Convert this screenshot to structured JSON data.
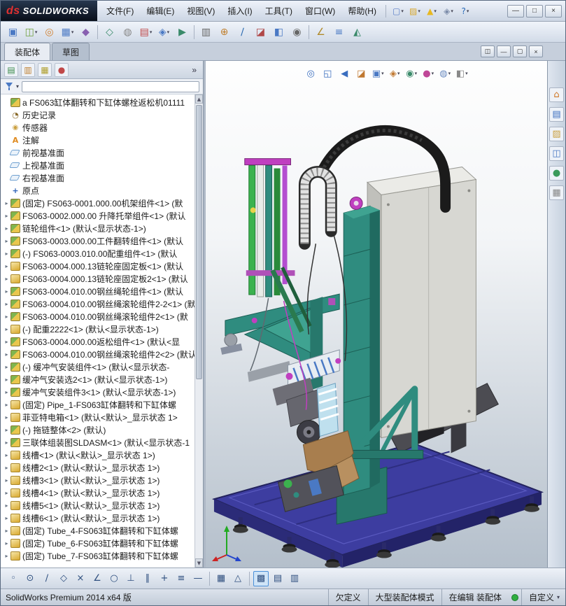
{
  "ui": {
    "dropdown_glyph": "▾"
  },
  "titlebar": {
    "brand": {
      "mark": "ds",
      "name": "SOLIDWORKS"
    },
    "menus": [
      {
        "id": "file",
        "label": "文件(F)"
      },
      {
        "id": "edit",
        "label": "编辑(E)"
      },
      {
        "id": "view",
        "label": "视图(V)"
      },
      {
        "id": "insert",
        "label": "插入(I)"
      },
      {
        "id": "tools",
        "label": "工具(T)"
      },
      {
        "id": "window",
        "label": "窗口(W)"
      },
      {
        "id": "help",
        "label": "帮助(H)"
      }
    ],
    "quick_icons": [
      {
        "name": "new-document-icon",
        "glyph": "▢",
        "color": "#5a7ec8",
        "dropdown": true
      },
      {
        "name": "open-icon",
        "glyph": "▨",
        "color": "#d8a830",
        "dropdown": true
      },
      {
        "name": "rebuild-alert-icon",
        "glyph": "▲",
        "color": "#e8b820",
        "dropdown": true
      },
      {
        "name": "options-icon",
        "glyph": "◈",
        "color": "#7a8aa8",
        "dropdown": true
      },
      {
        "name": "help-icon",
        "glyph": "?",
        "color": "#2a6ab8",
        "dropdown": true
      }
    ],
    "window_controls": [
      {
        "name": "minimize-button",
        "glyph": "—"
      },
      {
        "name": "maximize-button",
        "glyph": "□"
      },
      {
        "name": "close-button",
        "glyph": "×"
      }
    ]
  },
  "toolbar": {
    "icons": [
      {
        "name": "edit-component-icon",
        "glyph": "▣",
        "color": "#4a79c4"
      },
      {
        "name": "insert-components-icon",
        "glyph": "◫",
        "color": "#6fa03c",
        "dropdown": true
      },
      {
        "name": "mate-icon",
        "glyph": "◎",
        "color": "#d08030"
      },
      {
        "name": "component-pattern-icon",
        "glyph": "▦",
        "color": "#4a79c4",
        "dropdown": true
      },
      {
        "name": "smart-fasteners-icon",
        "glyph": "◆",
        "color": "#8860b0"
      },
      {
        "name": "move-component-icon",
        "glyph": "◇",
        "color": "#3a8a6a",
        "sep": true
      },
      {
        "name": "show-hidden-components-icon",
        "glyph": "◍",
        "color": "#888888"
      },
      {
        "name": "assembly-features-icon",
        "glyph": "▤",
        "color": "#c04848",
        "dropdown": true
      },
      {
        "name": "reference-geometry-icon",
        "glyph": "◈",
        "color": "#4a79c4",
        "dropdown": true
      },
      {
        "name": "new-motion-study-icon",
        "glyph": "▶",
        "color": "#3a8a6a"
      },
      {
        "name": "bill-of-materials-icon",
        "glyph": "▥",
        "color": "#666666",
        "sep": true
      },
      {
        "name": "exploded-view-icon",
        "glyph": "⊕",
        "color": "#c08030"
      },
      {
        "name": "explode-line-sketch-icon",
        "glyph": "∕",
        "color": "#2a6ab0"
      },
      {
        "name": "interference-detection-icon",
        "glyph": "◪",
        "color": "#b04848"
      },
      {
        "name": "clearance-verification-icon",
        "glyph": "◧",
        "color": "#4a79c4"
      },
      {
        "name": "hole-alignment-icon",
        "glyph": "◉",
        "color": "#666666"
      },
      {
        "name": "measure-icon",
        "glyph": "∠",
        "color": "#b08a2a",
        "sep": true
      },
      {
        "name": "mass-properties-icon",
        "glyph": "≡",
        "color": "#4a79c4"
      },
      {
        "name": "section-properties-icon",
        "glyph": "◭",
        "color": "#3a8a6a"
      }
    ]
  },
  "tabs": {
    "items": [
      {
        "id": "assembly",
        "label": "装配体",
        "active": true
      },
      {
        "id": "sketch",
        "label": "草图",
        "active": false
      }
    ]
  },
  "doc_controls": [
    {
      "name": "pane-toggle-button",
      "glyph": "◫"
    },
    {
      "name": "doc-minimize-button",
      "glyph": "—"
    },
    {
      "name": "doc-restore-button",
      "glyph": "▢"
    },
    {
      "name": "doc-close-button",
      "glyph": "×"
    }
  ],
  "feature_panel": {
    "header_icons": [
      {
        "name": "featuremanager-tab-icon",
        "glyph": "▤",
        "color": "#3a8a4a"
      },
      {
        "name": "propertymanager-tab-icon",
        "glyph": "▥",
        "color": "#c08030"
      },
      {
        "name": "configurationmanager-tab-icon",
        "glyph": "▦",
        "color": "#b0a030"
      },
      {
        "name": "displaymanager-tab-icon",
        "glyph": "●",
        "color": "#c04848"
      }
    ],
    "more_label": "»",
    "scrollbar": {
      "up": "▲",
      "down": "▼"
    },
    "tree": {
      "expander_glyph": "▸",
      "icon_glyphs": {
        "annotations-icon": "A",
        "origin-icon": "+",
        "history-icon": "◔",
        "sensors-icon": "◉"
      },
      "items": [
        {
          "label": "a FS063缸体翻转和下缸体螺栓返松机01111",
          "icon": "assembly-icon",
          "expand": false
        },
        {
          "label": "历史记录",
          "icon": "history-icon",
          "expand": false
        },
        {
          "label": "传感器",
          "icon": "sensors-icon",
          "expand": false
        },
        {
          "label": "注解",
          "icon": "annotations-icon",
          "expand": false
        },
        {
          "label": "前视基准面",
          "icon": "plane-icon",
          "expand": false
        },
        {
          "label": "上视基准面",
          "icon": "plane-icon",
          "expand": false
        },
        {
          "label": "右视基准面",
          "icon": "plane-icon",
          "expand": false
        },
        {
          "label": "原点",
          "icon": "origin-icon",
          "expand": false
        },
        {
          "label": "(固定) FS063-0001.000.00机架组件<1> (默",
          "icon": "subassembly-icon",
          "expand": true
        },
        {
          "label": "FS063-0002.000.00 升降托举组件<1> (默认",
          "icon": "subassembly-icon",
          "expand": true
        },
        {
          "label": "链轮组件<1> (默认<显示状态-1>)",
          "icon": "subassembly-icon",
          "expand": true
        },
        {
          "label": "FS063-0003.000.00工件翻转组件<1> (默认",
          "icon": "subassembly-icon",
          "expand": true
        },
        {
          "label": "(-) FS063-0003.010.00配重组件<1> (默认",
          "icon": "subassembly-icon",
          "expand": true
        },
        {
          "label": "FS063-0004.000.13链轮座固定板<1> (默认",
          "icon": "part-icon",
          "expand": true
        },
        {
          "label": "FS063-0004.000.13链轮座固定板2<1> (默认",
          "icon": "part-icon",
          "expand": true
        },
        {
          "label": "FS063-0004.010.00钢丝绳轮组件<1> (默认",
          "icon": "subassembly-icon",
          "expand": true
        },
        {
          "label": "FS063-0004.010.00钢丝绳滚轮组件2-2<1> (默",
          "icon": "subassembly-icon",
          "expand": true
        },
        {
          "label": "FS063-0004.010.00钢丝绳滚轮组件2<1> (默",
          "icon": "subassembly-icon",
          "expand": true
        },
        {
          "label": "(-) 配重2222<1> (默认<显示状态-1>)",
          "icon": "part-icon",
          "expand": true
        },
        {
          "label": "FS063-0004.000.00返松组件<1> (默认<显",
          "icon": "subassembly-icon",
          "expand": true
        },
        {
          "label": "FS063-0004.010.00钢丝绳滚轮组件2<2> (默认",
          "icon": "subassembly-icon",
          "expand": true
        },
        {
          "label": "(-) 缓冲气安装组件<1> (默认<显示状态-",
          "icon": "subassembly-icon",
          "expand": true
        },
        {
          "label": "缓冲气安装选2<1> (默认<显示状态-1>)",
          "icon": "subassembly-icon",
          "expand": true
        },
        {
          "label": "缓冲气安装组件3<1> (默认<显示状态-1>)",
          "icon": "subassembly-icon",
          "expand": true
        },
        {
          "label": "(固定) Pipe_1-FS063缸体翻转和下缸体螺",
          "icon": "part-icon",
          "expand": true
        },
        {
          "label": "菲亚特电箱<1> (默认<默认>_显示状态 1>",
          "icon": "part-icon",
          "expand": true
        },
        {
          "label": "(-) 拖链整体<2> (默认)",
          "icon": "subassembly-icon",
          "expand": true
        },
        {
          "label": "三联体组装图SLDASM<1> (默认<显示状态-1",
          "icon": "subassembly-icon",
          "expand": true
        },
        {
          "label": "线槽<1> (默认<默认>_显示状态 1>)",
          "icon": "part-icon",
          "expand": true
        },
        {
          "label": "线槽2<1> (默认<默认>_显示状态 1>)",
          "icon": "part-icon",
          "expand": true
        },
        {
          "label": "线槽3<1> (默认<默认>_显示状态 1>)",
          "icon": "part-icon",
          "expand": true
        },
        {
          "label": "线槽4<1> (默认<默认>_显示状态 1>)",
          "icon": "part-icon",
          "expand": true
        },
        {
          "label": "线槽5<1> (默认<默认>_显示状态 1>)",
          "icon": "part-icon",
          "expand": true
        },
        {
          "label": "线槽6<1> (默认<默认>_显示状态 1>)",
          "icon": "part-icon",
          "expand": true
        },
        {
          "label": "(固定) Tube_4-FS063缸体翻转和下缸体螺",
          "icon": "part-icon",
          "expand": true
        },
        {
          "label": "(固定) Tube_6-FS063缸体翻转和下缸体螺",
          "icon": "part-icon",
          "expand": true
        },
        {
          "label": "(固定) Tube_7-FS063缸体翻转和下缸体螺",
          "icon": "part-icon",
          "expand": true
        }
      ]
    }
  },
  "viewport": {
    "hud_icons": [
      {
        "name": "zoom-to-fit-icon",
        "glyph": "◎",
        "color": "#3a6ebf"
      },
      {
        "name": "zoom-to-area-icon",
        "glyph": "◱",
        "color": "#3a6ebf"
      },
      {
        "name": "previous-view-icon",
        "glyph": "◀",
        "color": "#3a6ebf"
      },
      {
        "name": "section-view-icon",
        "glyph": "◪",
        "color": "#c07830"
      },
      {
        "name": "view-orientation-icon",
        "glyph": "▣",
        "color": "#4a79c4",
        "dropdown": true
      },
      {
        "name": "display-style-icon",
        "glyph": "◈",
        "color": "#c07830",
        "dropdown": true
      },
      {
        "name": "hide-show-items-icon",
        "glyph": "◉",
        "color": "#3a8a6a",
        "dropdown": true
      },
      {
        "name": "edit-appearance-icon",
        "glyph": "●",
        "color": "#c04898",
        "dropdown": true
      },
      {
        "name": "apply-scene-icon",
        "glyph": "◍",
        "color": "#6a8ac0",
        "dropdown": true
      },
      {
        "name": "view-settings-icon",
        "glyph": "◧",
        "color": "#888888",
        "dropdown": true
      }
    ],
    "model_colors": {
      "base": "#3d3da0",
      "frame": "#2f8c7f",
      "cabinet": "#d7d7d2",
      "chain": "#1b1b1b",
      "accent": "#c03fc0"
    },
    "triad_colors": {
      "x": "#cc2222",
      "y": "#22aa22",
      "z": "#2244cc"
    }
  },
  "task_pane": {
    "icons": [
      {
        "name": "resources-home-icon",
        "glyph": "⌂",
        "color": "#d07828"
      },
      {
        "name": "design-library-icon",
        "glyph": "▤",
        "color": "#3a6ebf"
      },
      {
        "name": "file-explorer-icon",
        "glyph": "▨",
        "color": "#caa040"
      },
      {
        "name": "view-palette-icon",
        "glyph": "◫",
        "color": "#4a79c4"
      },
      {
        "name": "appearances-icon",
        "glyph": "●",
        "color": "#3a9a5a"
      },
      {
        "name": "custom-properties-icon",
        "glyph": "▦",
        "color": "#888888"
      }
    ]
  },
  "bottom_toolbar": {
    "icons": [
      {
        "name": "point-snap-icon",
        "glyph": "◦"
      },
      {
        "name": "center-snap-icon",
        "glyph": "⊙"
      },
      {
        "name": "midpoint-snap-icon",
        "glyph": "∕"
      },
      {
        "name": "quadrant-snap-icon",
        "glyph": "◇"
      },
      {
        "name": "intersection-snap-icon",
        "glyph": "×"
      },
      {
        "name": "nearest-snap-icon",
        "glyph": "∠"
      },
      {
        "name": "tangent-snap-icon",
        "glyph": "○"
      },
      {
        "name": "perpendicular-snap-icon",
        "glyph": "⊥"
      },
      {
        "name": "parallel-snap-icon",
        "glyph": "∥"
      },
      {
        "name": "hv-snap-icon",
        "glyph": "+"
      },
      {
        "name": "hv-points-snap-icon",
        "glyph": "≡"
      },
      {
        "name": "length-snap-icon",
        "glyph": "—"
      },
      {
        "name": "grid-snap-icon",
        "glyph": "▦",
        "sep": true
      },
      {
        "name": "angle-snap-icon",
        "glyph": "△"
      },
      {
        "name": "grid-display-icon",
        "glyph": "▩",
        "sep": true,
        "active": true
      },
      {
        "name": "snap-settings-icon",
        "glyph": "▤"
      },
      {
        "name": "table-icon",
        "glyph": "▥"
      }
    ]
  },
  "statusbar": {
    "left": "SolidWorks Premium 2014 x64 版",
    "cells": [
      {
        "label": "欠定义"
      },
      {
        "label": "大型装配体模式"
      },
      {
        "label": "在编辑 装配体"
      }
    ],
    "status_icon_color": "#2fae3f",
    "custom_label": "自定义"
  }
}
